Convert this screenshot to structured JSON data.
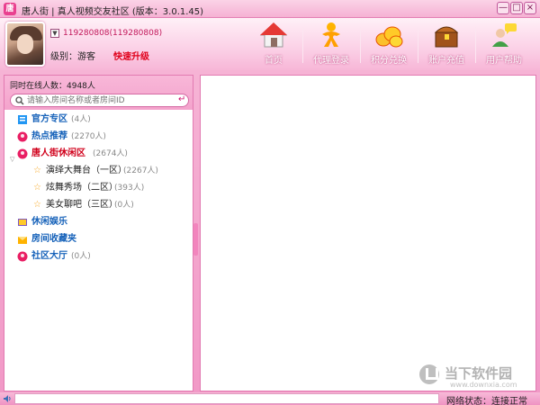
{
  "window": {
    "title": "唐人街 | 真人视频交友社区 (版本：3.0.1.45)",
    "controls": {
      "minimize": "—",
      "maximize": "□",
      "close": "×"
    }
  },
  "user": {
    "id_text": "119280808(119280808)",
    "level_label": "级别：游客",
    "upgrade_link": "快速升级"
  },
  "nav": [
    {
      "label": "首页",
      "icon": "home-icon"
    },
    {
      "label": "代理登录",
      "icon": "agent-login-icon"
    },
    {
      "label": "积分兑换",
      "icon": "coins-icon"
    },
    {
      "label": "账户充值",
      "icon": "treasure-chest-icon"
    },
    {
      "label": "用户帮助",
      "icon": "user-help-icon"
    }
  ],
  "sidebar": {
    "online_count": "同时在线人数：4948人",
    "search_placeholder": "请输入房间名称或者房间ID",
    "search_enter": "↵",
    "expand_marker": "▽",
    "tree": [
      {
        "name": "官方专区",
        "count": "(4人)",
        "icon": "official-zone-icon",
        "style": "cat",
        "level": 0
      },
      {
        "name": "热点推荐",
        "count": "(2270人)",
        "icon": "hot-recommend-icon",
        "style": "cat",
        "level": 0
      },
      {
        "name": "唐人街休闲区",
        "count": "(2674人)",
        "icon": "leisure-zone-icon",
        "style": "cat-red",
        "level": 0,
        "expanded": true
      },
      {
        "name": "演绎大舞台（一区）",
        "count": "(2267人)",
        "icon": "star-icon",
        "style": "sub",
        "level": 1
      },
      {
        "name": "炫舞秀场（二区）",
        "count": "(393人)",
        "icon": "star-icon",
        "style": "sub",
        "level": 1
      },
      {
        "name": "美女聊吧（三区）",
        "count": "(0人)",
        "icon": "star-icon",
        "style": "sub",
        "level": 1
      },
      {
        "name": "休闲娱乐",
        "count": "",
        "icon": "entertainment-icon",
        "style": "cat",
        "level": 0
      },
      {
        "name": "房间收藏夹",
        "count": "",
        "icon": "favorites-icon",
        "style": "cat",
        "level": 0
      },
      {
        "name": "社区大厅",
        "count": "(0人)",
        "icon": "community-hall-icon",
        "style": "cat",
        "level": 0
      }
    ]
  },
  "watermark": {
    "text": "当下软件园",
    "url": "www.downxia.com"
  },
  "statusbar": {
    "net_status": "网络状态：连接正常"
  },
  "colors": {
    "accent": "#f198c6",
    "link_blue": "#1561b9",
    "alert_red": "#e0001b"
  }
}
